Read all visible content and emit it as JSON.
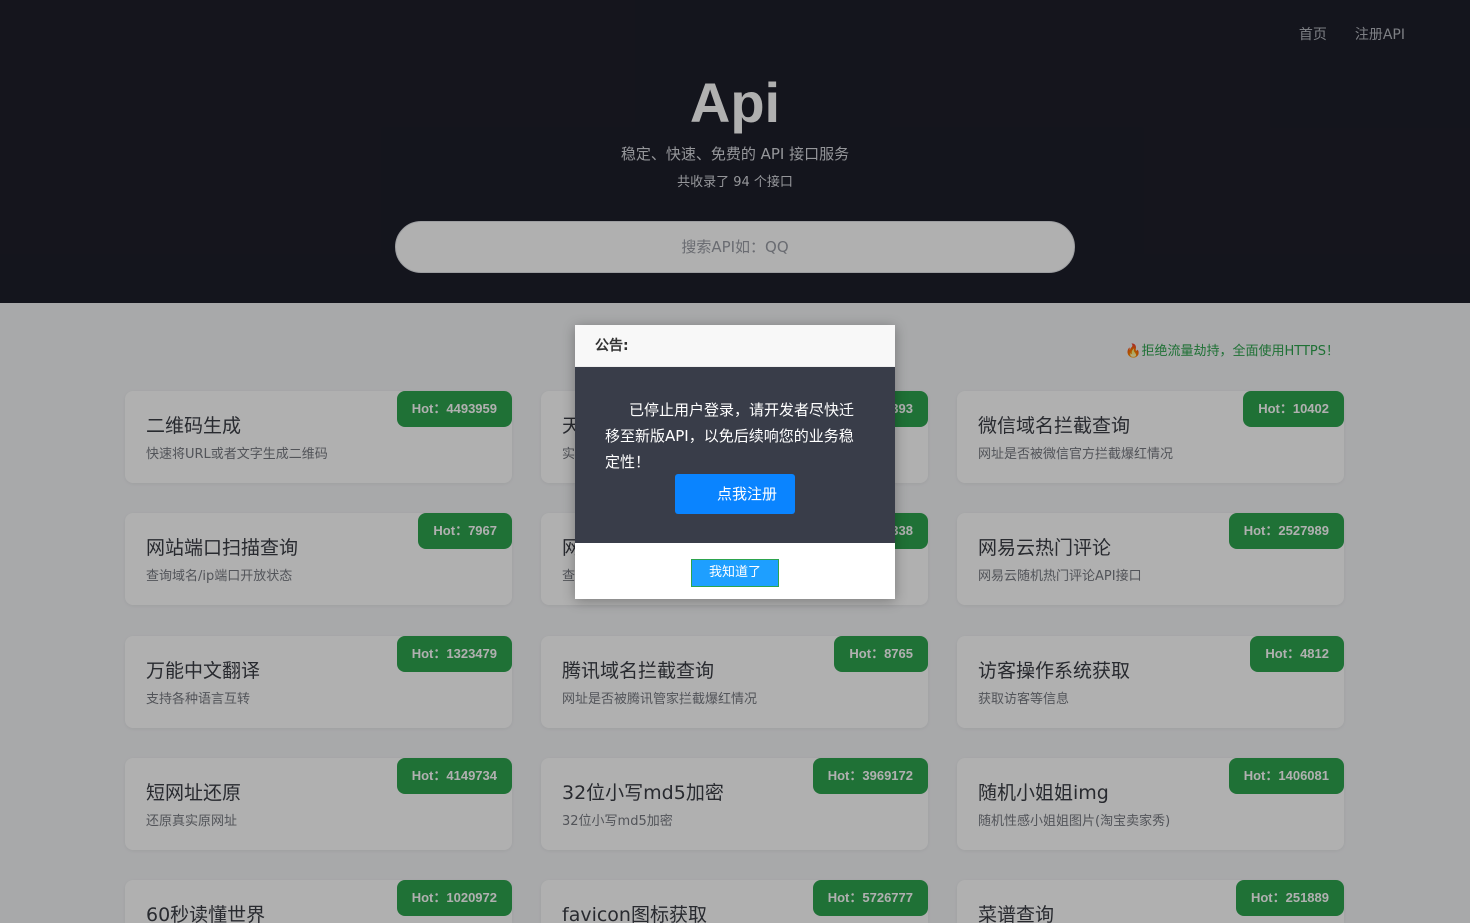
{
  "nav": {
    "home": "首页",
    "register": "注册API"
  },
  "brand": {
    "logo": "Api",
    "subtitle": "稳定、快速、免费的 API 接口服务",
    "count_text": "共收录了 94 个接口"
  },
  "search": {
    "placeholder": "搜索API如：QQ"
  },
  "notice": "🔥拒绝流量劫持，全面使用HTTPS！",
  "cards": [
    {
      "title": "二维码生成",
      "desc": "快速将URL或者文字生成二维码",
      "hot": "Hot：4493959"
    },
    {
      "title": "天",
      "desc": "实",
      "hot": "393"
    },
    {
      "title": "微信域名拦截查询",
      "desc": "网址是否被微信官方拦截爆红情况",
      "hot": "Hot：10402"
    },
    {
      "title": "网站端口扫描查询",
      "desc": "查询域名/ip端口开放状态",
      "hot": "Hot：7967"
    },
    {
      "title": "网",
      "desc": "查",
      "hot": "338"
    },
    {
      "title": "网易云热门评论",
      "desc": "网易云随机热门评论API接口",
      "hot": "Hot：2527989"
    },
    {
      "title": "万能中文翻译",
      "desc": "支持各种语言互转",
      "hot": "Hot：1323479"
    },
    {
      "title": "腾讯域名拦截查询",
      "desc": "网址是否被腾讯管家拦截爆红情况",
      "hot": "Hot：8765"
    },
    {
      "title": "访客操作系统获取",
      "desc": "获取访客等信息",
      "hot": "Hot：4812"
    },
    {
      "title": "短网址还原",
      "desc": "还原真实原网址",
      "hot": "Hot：4149734"
    },
    {
      "title": "32位小写md5加密",
      "desc": "32位小写md5加密",
      "hot": "Hot：3969172"
    },
    {
      "title": "随机小姐姐img",
      "desc": "随机性感小姐姐图片(淘宝卖家秀)",
      "hot": "Hot：1406081"
    },
    {
      "title": "60秒读懂世界",
      "desc": "",
      "hot": "Hot：1020972"
    },
    {
      "title": "favicon图标获取",
      "desc": "",
      "hot": "Hot：5726777"
    },
    {
      "title": "菜谱查询",
      "desc": "",
      "hot": "Hot：251889"
    }
  ],
  "modal": {
    "title": "公告:",
    "message": "已停止用户登录，请开发者尽快迁移至新版API，以免后续响您的业务稳定性！",
    "register_button": "点我注册",
    "ok_button": "我知道了"
  }
}
